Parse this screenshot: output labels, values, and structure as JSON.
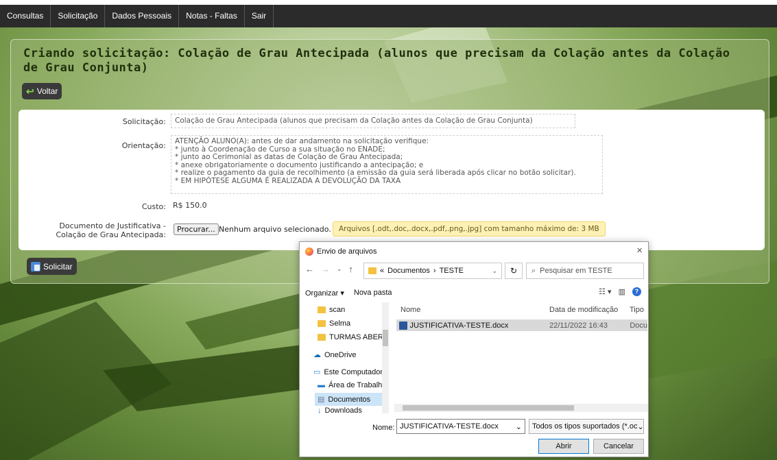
{
  "nav": {
    "items": [
      "Consultas",
      "Solicitação",
      "Dados Pessoais",
      "Notas - Faltas",
      "Sair"
    ]
  },
  "page": {
    "title": "Criando solicitação: Colação de Grau Antecipada (alunos que precisam da Colação antes da Colação de Grau Conjunta)",
    "back_label": "Voltar",
    "submit_label": "Solicitar"
  },
  "form": {
    "solicitacao_label": "Solicitação:",
    "solicitacao_value": "Colação de Grau Antecipada (alunos que precisam da Colação antes da Colação de Grau Conjunta)",
    "orientacao_label": "Orientação:",
    "orientacao_lines": [
      "ATENÇÃO ALUNO(A): antes de dar andamento na solicitação verifique:",
      "* junto à Coordenação de Curso a sua situação no ENADE;",
      "* junto ao Cerimonial as datas de Colação de Grau Antecipada;",
      "* anexe obrigatoriamente o documento justificando a antecipação; e",
      "* realize o pagamento da guia de recolhimento (a emissão da guia será liberada após clicar no botão solicitar).",
      "* EM HIPÓTESE ALGUMA É REALIZADA A DEVOLUÇÃO DA TAXA"
    ],
    "custo_label": "Custo:",
    "custo_value": "R$ 150.0",
    "documento_label_1": "Documento de Justificativa -",
    "documento_label_2": "Colação de Grau Antecipada:",
    "file_button": "Procurar...",
    "file_status": "Nenhum arquivo selecionado.",
    "file_hint": "Arquivos [.odt,.doc,.docx,.pdf,.png,.jpg] com tamanho máximo de: 3 MB"
  },
  "dialog": {
    "title": "Envio de arquivos",
    "path": [
      "«",
      "Documentos",
      "›",
      "TESTE"
    ],
    "search_placeholder": "Pesquisar em TESTE",
    "organize": "Organizar ▾",
    "new_folder": "Nova pasta",
    "tree": [
      "scan",
      "Selma",
      "TURMAS ABERTA",
      "OneDrive",
      "Este Computador",
      "Área de Trabalho",
      "Documentos",
      "Downloads"
    ],
    "columns": [
      "Nome",
      "Data de modificação",
      "Tipo"
    ],
    "file": {
      "name": "JUSTIFICATIVA-TESTE.docx",
      "date": "22/11/2022 16:43",
      "type": "Docu"
    },
    "name_label": "Nome:",
    "name_value": "JUSTIFICATIVA-TESTE.docx",
    "type_filter": "Todos os tipos suportados (*.oc",
    "open_button": "Abrir",
    "cancel_button": "Cancelar"
  },
  "colors": {
    "nav_bg": "#2b2b2b",
    "title_text": "#1f2f0c",
    "hint_bg": "#fdf1b6",
    "selected_row": "#d9d9d9"
  }
}
